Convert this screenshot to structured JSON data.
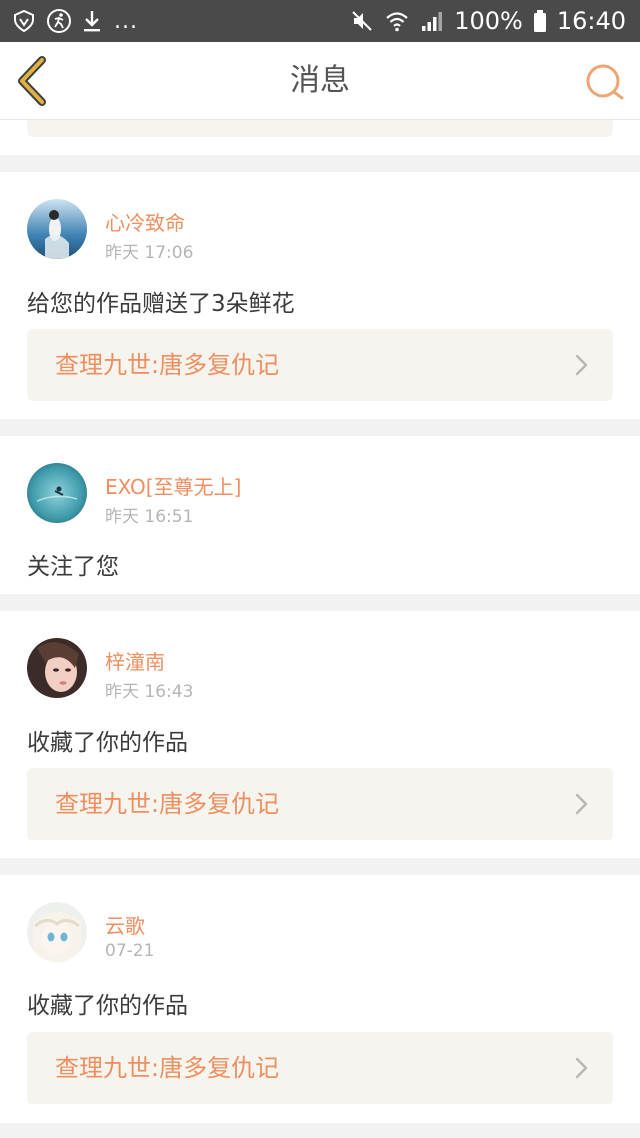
{
  "status_bar": {
    "battery": "100%",
    "time": "16:40",
    "dots": "..."
  },
  "header": {
    "title": "消息"
  },
  "messages": [
    {
      "user": "心冷致命",
      "time": "昨天 17:06",
      "text": "给您的作品赠送了3朵鲜花",
      "work": "查理九世:唐多复仇记"
    },
    {
      "user": "EXO[至尊无上]",
      "time": "昨天 16:51",
      "text": "关注了您"
    },
    {
      "user": "梓潼南",
      "time": "昨天 16:43",
      "text": "收藏了你的作品",
      "work": "查理九世:唐多复仇记"
    },
    {
      "user": "云歌",
      "time": "07-21",
      "text": "收藏了你的作品",
      "work": "查理九世:唐多复仇记"
    }
  ],
  "colors": {
    "accent": "#ef8e5e",
    "back_arrow": "#e0b040",
    "link_box_bg": "#f5f4ee"
  }
}
